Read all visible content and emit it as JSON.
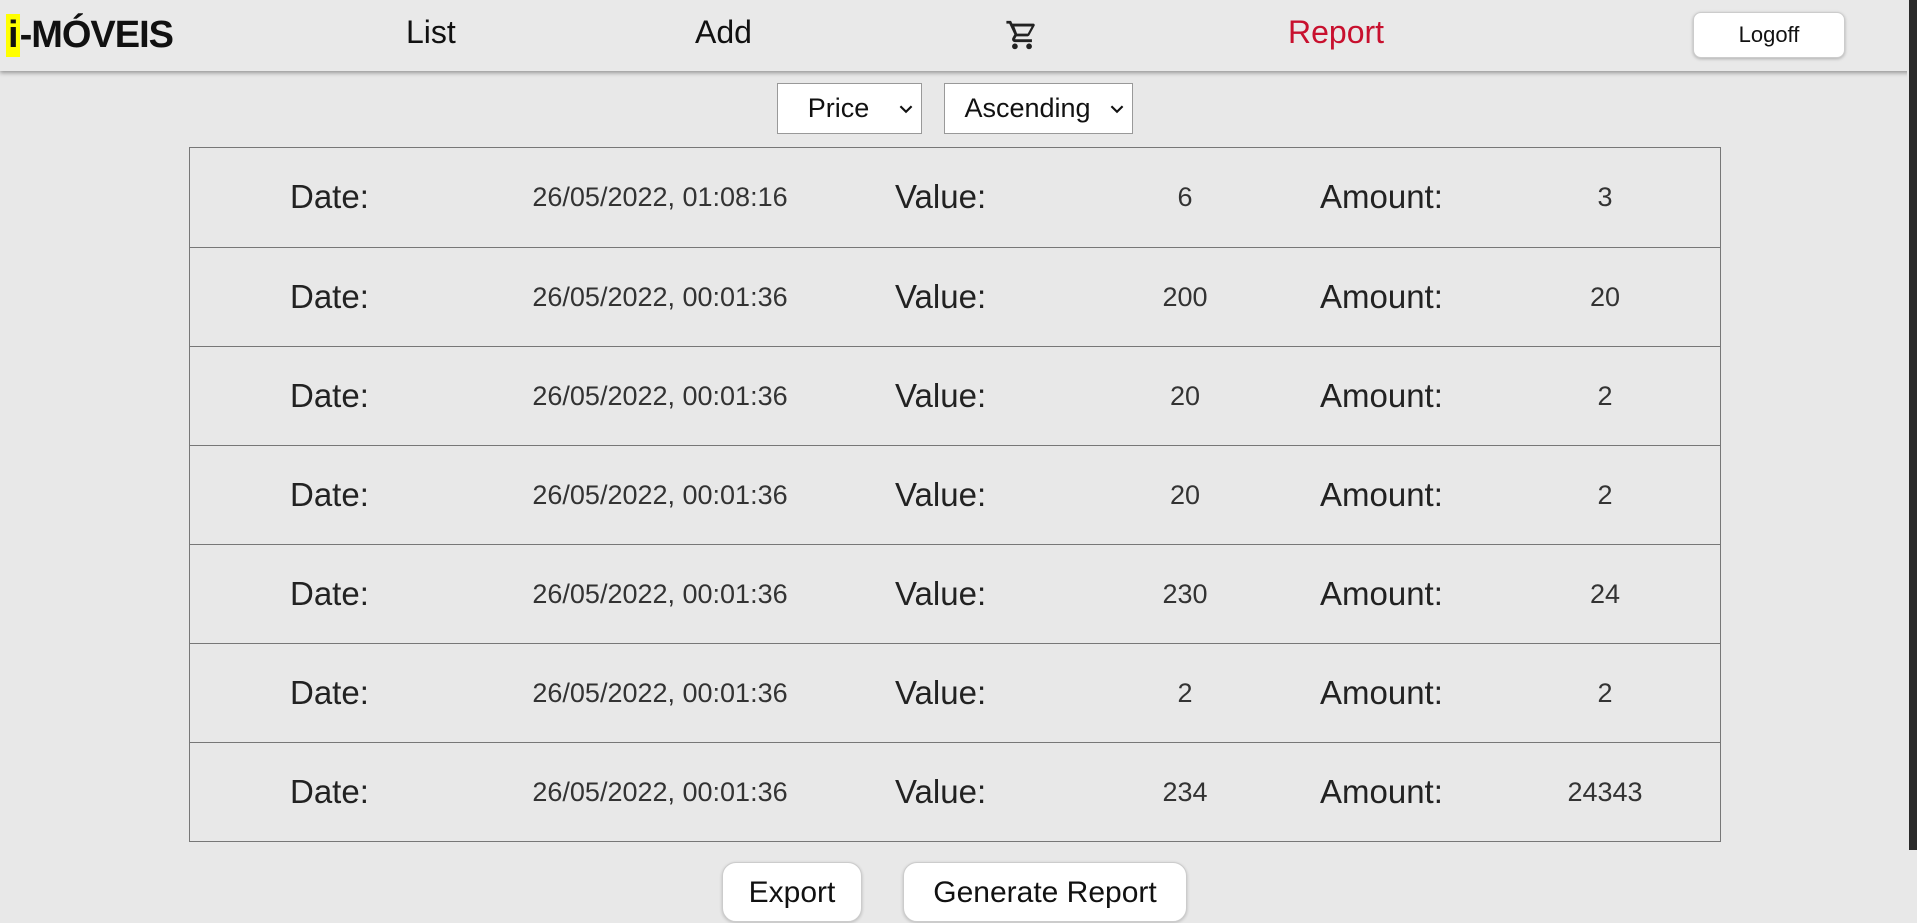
{
  "app": {
    "logo_i": "i",
    "logo_rest": "-MÓVEIS"
  },
  "nav": {
    "list": "List",
    "add": "Add",
    "report": "Report",
    "logoff": "Logoff",
    "cart_icon": "cart-icon"
  },
  "colors": {
    "active": "#c8102e",
    "logo_highlight": "#ffff00",
    "background": "#e8e8e8"
  },
  "filters": {
    "sort_field": "Price",
    "sort_order": "Ascending"
  },
  "labels": {
    "date": "Date:",
    "value": "Value:",
    "amount": "Amount:"
  },
  "rows": [
    {
      "date": "26/05/2022, 01:08:16",
      "value": "6",
      "amount": "3"
    },
    {
      "date": "26/05/2022, 00:01:36",
      "value": "200",
      "amount": "20"
    },
    {
      "date": "26/05/2022, 00:01:36",
      "value": "20",
      "amount": "2"
    },
    {
      "date": "26/05/2022, 00:01:36",
      "value": "20",
      "amount": "2"
    },
    {
      "date": "26/05/2022, 00:01:36",
      "value": "230",
      "amount": "24"
    },
    {
      "date": "26/05/2022, 00:01:36",
      "value": "2",
      "amount": "2"
    },
    {
      "date": "26/05/2022, 00:01:36",
      "value": "234",
      "amount": "24343"
    }
  ],
  "actions": {
    "export": "Export",
    "generate_report": "Generate Report"
  }
}
